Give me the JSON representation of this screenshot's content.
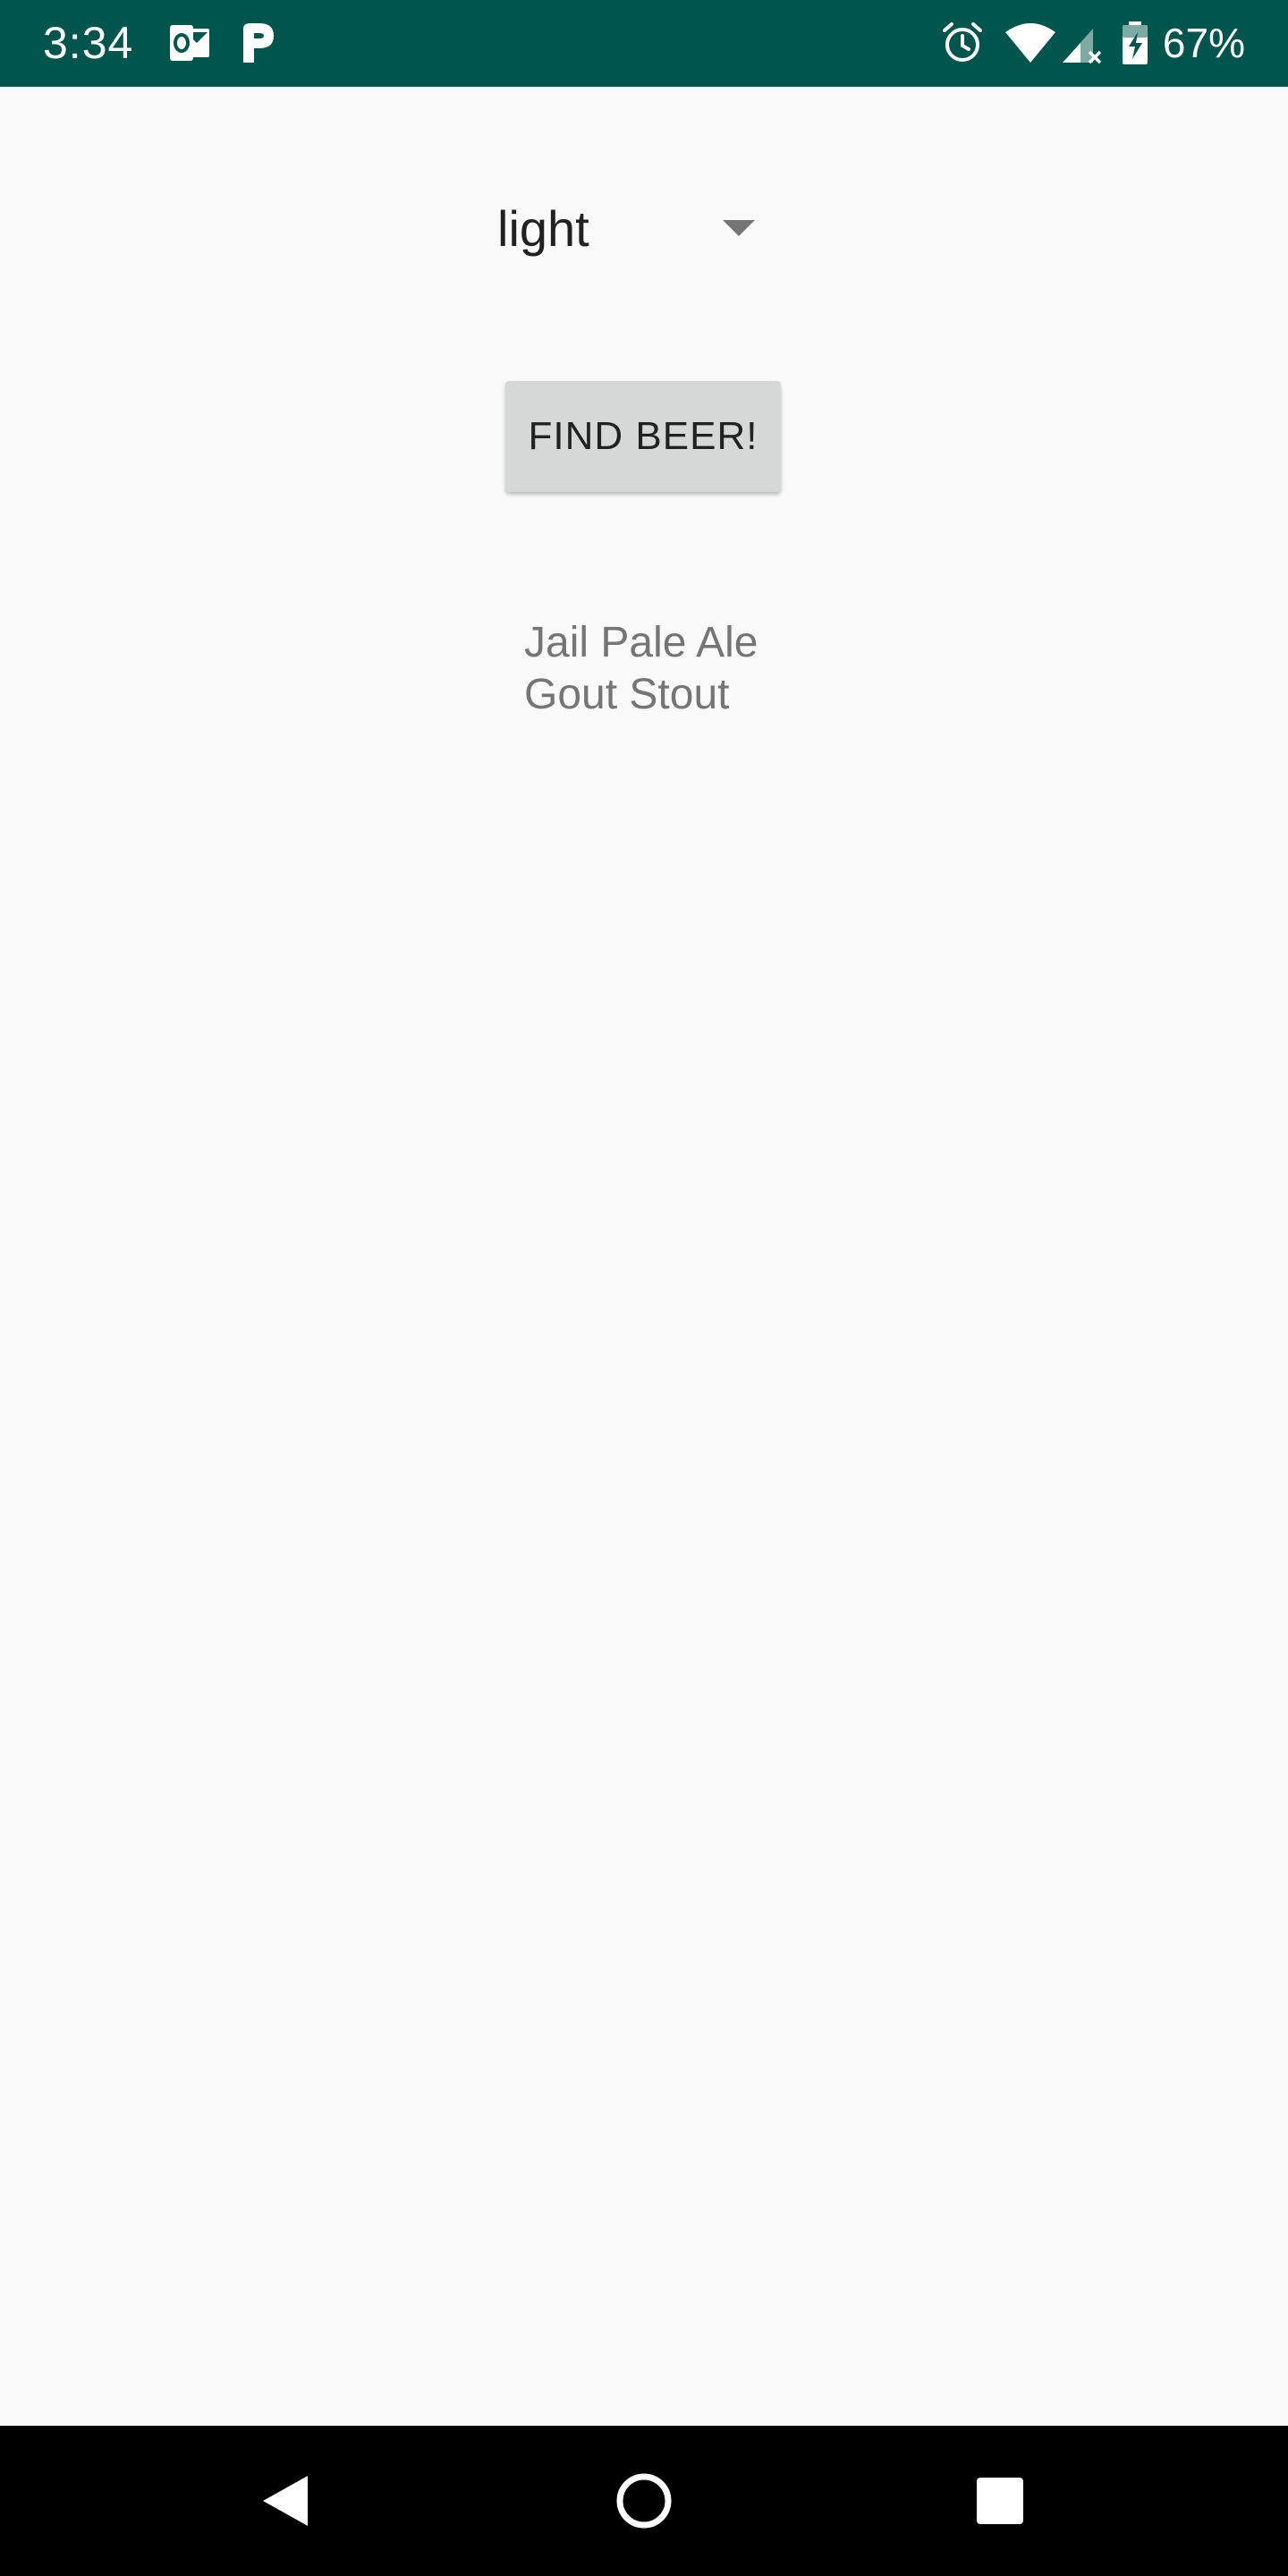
{
  "status_bar": {
    "time": "3:34",
    "battery_percent": "67%",
    "background_color": "#00564c",
    "left_icons": [
      "outlook-icon",
      "parking-icon"
    ],
    "right_icons": [
      "alarm-icon",
      "wifi-icon",
      "cell-signal-icon",
      "battery-charging-icon"
    ]
  },
  "spinner": {
    "selected_value": "light"
  },
  "find_button": {
    "label": "FIND BEER!"
  },
  "results": {
    "items": [
      "Jail Pale Ale",
      "Gout Stout"
    ]
  },
  "nav_bar": {
    "buttons": [
      "back-icon",
      "home-icon",
      "recents-icon"
    ]
  }
}
